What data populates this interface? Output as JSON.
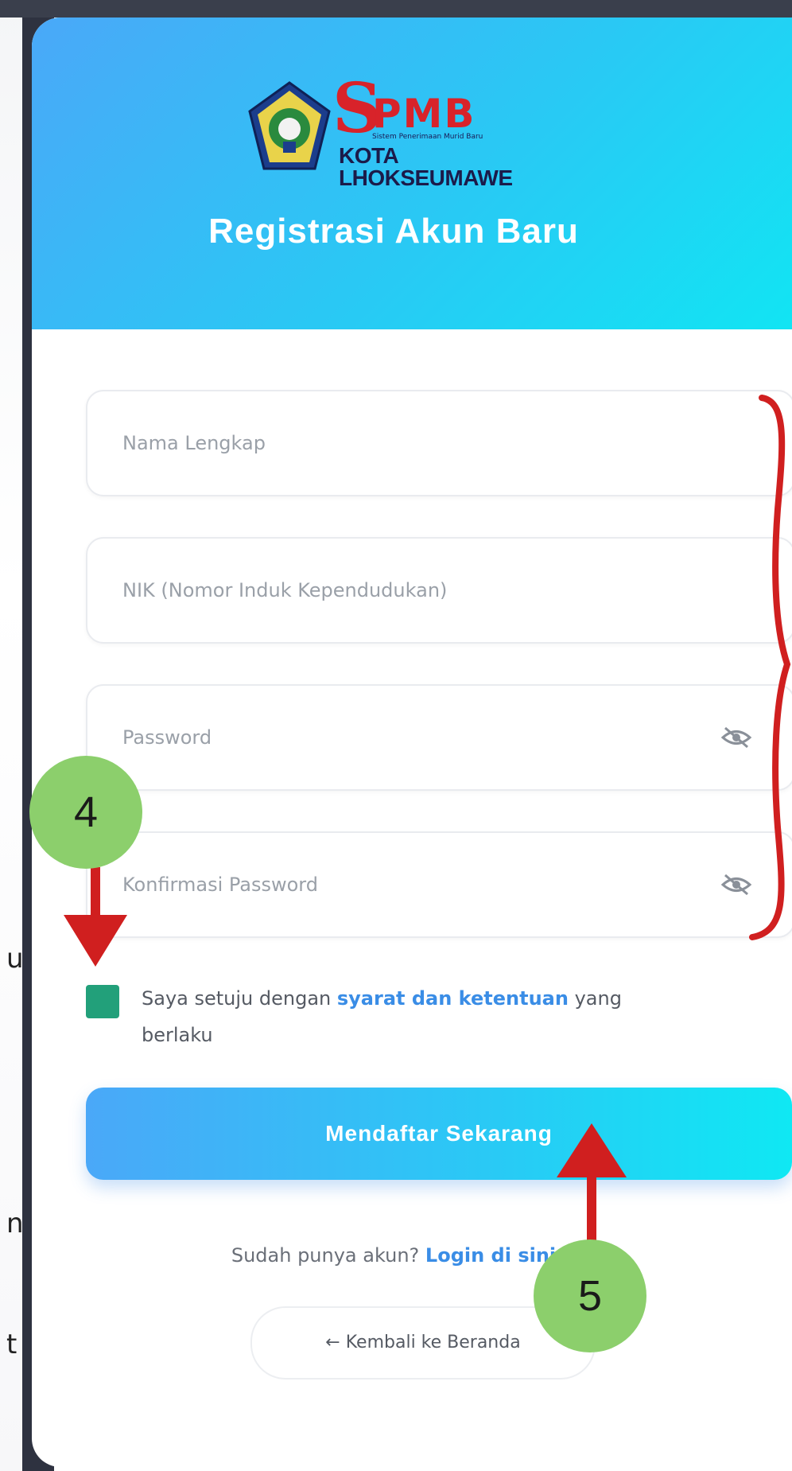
{
  "logo": {
    "s": "S",
    "pmb": "PMB",
    "sub": "Sistem Penerimaan Murid Baru",
    "city": "KOTA LHOKSEUMAWE"
  },
  "title": "Registrasi Akun Baru",
  "fields": {
    "nama": "Nama Lengkap",
    "nik": "NIK (Nomor Induk Kependudukan)",
    "password": "Password",
    "konfirmasi": "Konfirmasi Password"
  },
  "agree": {
    "prefix": "Saya setuju dengan ",
    "link": "syarat dan ketentuan",
    "suffix": " yang berlaku"
  },
  "submit_label": "Mendaftar Sekarang",
  "login": {
    "prefix": "Sudah punya akun? ",
    "link": "Login di sini"
  },
  "back_label": "← Kembali ke Beranda",
  "annotations": {
    "badge_4": "4",
    "badge_5": "5"
  },
  "side_text": [
    "u",
    "n",
    "t"
  ],
  "colors": {
    "header_start": "#4aa8f8",
    "header_end": "#10e6f3",
    "checkbox": "#22a07a",
    "link": "#3a8de6",
    "annotation_arrow": "#d01f1f",
    "annotation_badge": "#8ccf6c"
  }
}
